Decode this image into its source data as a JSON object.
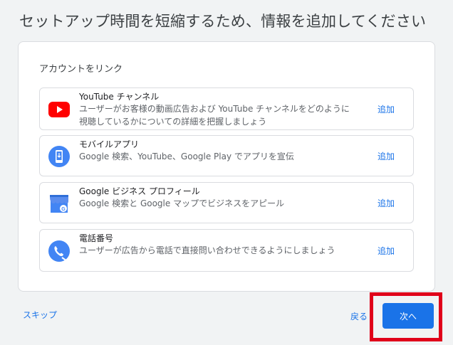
{
  "header": {
    "title": "セットアップ時間を短縮するため、情報を追加してください"
  },
  "card": {
    "section_title": "アカウントをリンク",
    "items": [
      {
        "title": "YouTube チャンネル",
        "description": "ユーザーがお客様の動画広告および YouTube チャンネルをどのように視聴しているかについての詳細を把握しましょう",
        "action_label": "追加",
        "icon": "youtube-icon"
      },
      {
        "title": "モバイルアプリ",
        "description": "Google 検索、YouTube、Google Play でアプリを宣伝",
        "action_label": "追加",
        "icon": "mobile-app-icon"
      },
      {
        "title": "Google ビジネス プロフィール",
        "description": "Google 検索と Google マップでビジネスをアピール",
        "action_label": "追加",
        "icon": "business-profile-icon"
      },
      {
        "title": "電話番号",
        "description": "ユーザーが広告から電話で直接問い合わせできるようにしましょう",
        "action_label": "追加",
        "icon": "phone-icon"
      }
    ]
  },
  "footer": {
    "skip_label": "スキップ",
    "back_label": "戻る",
    "next_label": "次へ"
  },
  "colors": {
    "accent": "#1a73e8",
    "highlight": "#e0001a",
    "youtube_red": "#ff0000"
  }
}
